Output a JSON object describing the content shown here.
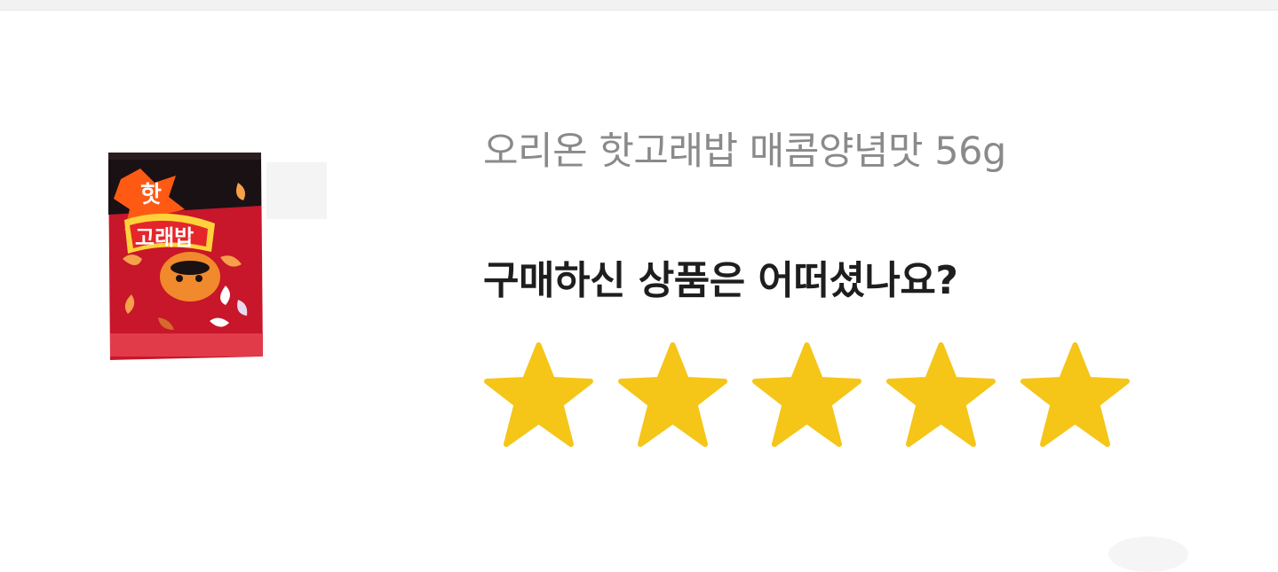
{
  "product": {
    "name": "오리온 핫고래밥 매콤양념맛 56g",
    "image_icon": "snack-package-image"
  },
  "review": {
    "question": "구매하신 상품은 어떠셨나요?",
    "rating": 5,
    "max_rating": 5,
    "star_color": "#F5C518"
  },
  "colors": {
    "product_name": "#8a8a8a",
    "question": "#1e1e1e",
    "divider": "#f2f2f2"
  }
}
